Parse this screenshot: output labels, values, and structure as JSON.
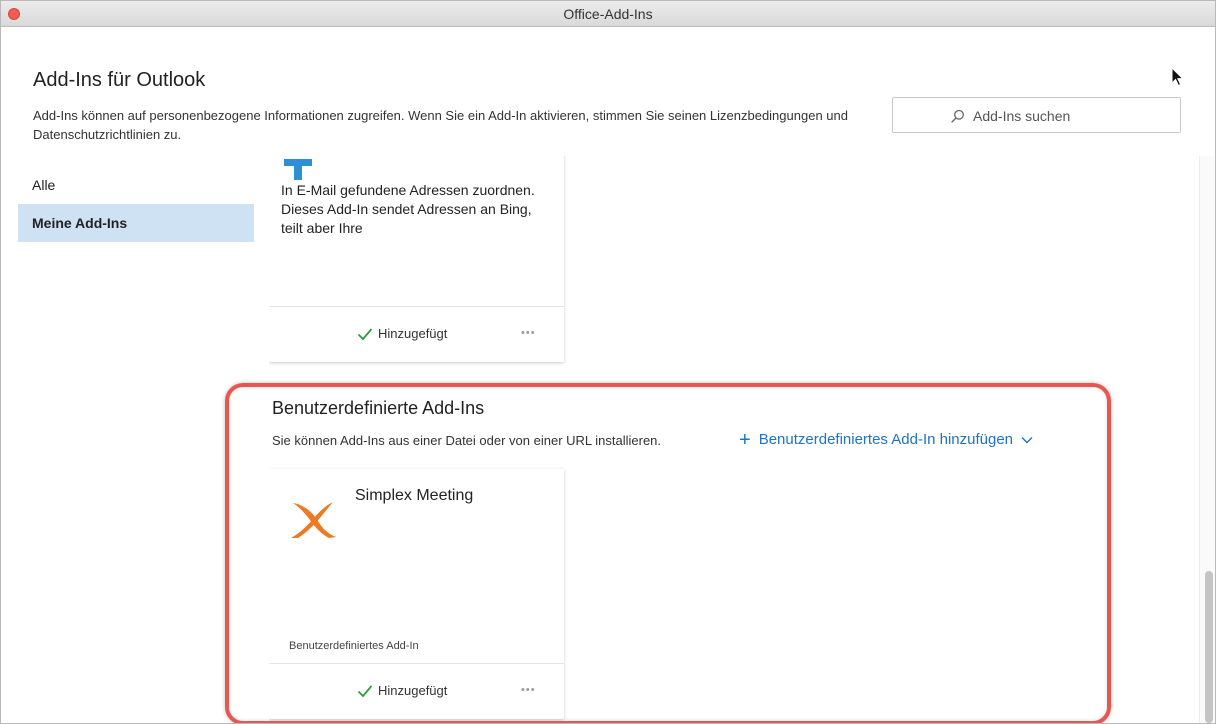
{
  "window": {
    "title": "Office-Add-Ins"
  },
  "header": {
    "heading": "Add-Ins für Outlook",
    "intro": "Add-Ins können auf personenbezogene Informationen zugreifen. Wenn Sie ein Add-In aktivieren, stimmen Sie seinen Lizenzbedingungen und Datenschutzrichtlinien zu."
  },
  "search": {
    "placeholder": "Add-Ins suchen"
  },
  "sidebar": {
    "items": [
      {
        "label": "Alle",
        "active": false
      },
      {
        "label": "Meine Add-Ins",
        "active": true
      }
    ]
  },
  "cards": {
    "maps": {
      "icon": "map-pin-icon",
      "description": "In E-Mail gefundene Adressen zuordnen. Dieses Add-In sendet Adressen an Bing, teilt aber Ihre",
      "status": "Hinzugefügt"
    },
    "simplex": {
      "icon": "simplex-x-logo",
      "name": "Simplex Meeting",
      "type": "Benutzerdefiniertes Add-In",
      "status": "Hinzugefügt"
    }
  },
  "custom_section": {
    "title": "Benutzerdefinierte Add-Ins",
    "description": "Sie können Add-Ins aus einer Datei oder von einer URL installieren.",
    "add_label": "Benutzerdefiniertes Add-In hinzufügen"
  },
  "colors": {
    "accent": "#1e73c8",
    "active_nav": "#cfe2f3",
    "highlight_frame": "#e85650",
    "close_button": "#f25b52",
    "check": "#2e9d3e",
    "simplex_orange": "#ee7a23"
  }
}
